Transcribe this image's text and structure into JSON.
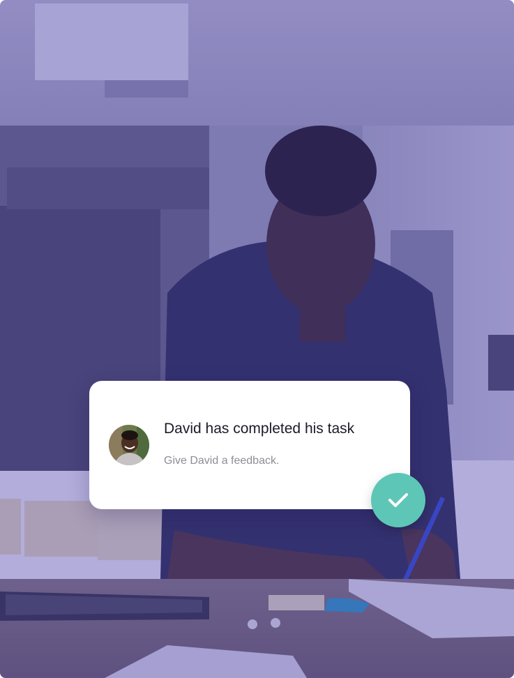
{
  "background": {
    "icon": "office-workspace-photo",
    "tint_color": "#483caa"
  },
  "notification": {
    "title": "David has completed his task",
    "subtitle": "Give David a feedback.",
    "avatar_icon": "user-avatar",
    "action_icon": "checkmark-icon",
    "action_color": "#5ec6b6"
  }
}
